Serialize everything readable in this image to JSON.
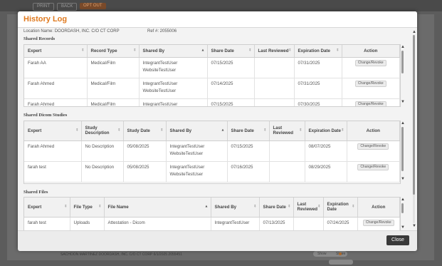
{
  "background": {
    "print_label": "PRINT",
    "back_label": "BACK",
    "opt_out_label": "OPT OUT",
    "row_text": "SACHOON MARTINEZ   DOORDASH, INC. C/O CT CORP   6/1/2025   2055451",
    "toggle_left": "Show",
    "toggle_right": "Share"
  },
  "modal": {
    "title": "History Log",
    "location_label": "Location Name: DOORDASH, INC. C/O CT CORP",
    "ref_label": "Ref #: 2055006",
    "close_label": "Close"
  },
  "shared_records": {
    "title": "Shared Records",
    "columns": [
      "Expert",
      "Record Type",
      "Shared By",
      "Share Date",
      "Last Reviewed",
      "Expiration Date",
      "Action"
    ],
    "rows": [
      {
        "expert": "Farah AA",
        "record_type": "Medical/Film",
        "shared_by_1": "IntegrantTestUser",
        "shared_by_2": "WebsiteTestUser",
        "share_date": "07/15/2025",
        "last_reviewed": "",
        "expiration_date": "07/31/2025",
        "action": "Change/Revoke"
      },
      {
        "expert": "Farah Ahmed",
        "record_type": "Medical/Film",
        "shared_by_1": "IntegrantTestUser",
        "shared_by_2": "WebsiteTestUser",
        "share_date": "07/14/2025",
        "last_reviewed": "",
        "expiration_date": "07/31/2025",
        "action": "Change/Revoke"
      },
      {
        "expert": "Farah Ahmed",
        "record_type": "Medical/Film",
        "shared_by_1": "IntegrantTestUser",
        "shared_by_2": "",
        "share_date": "07/15/2025",
        "last_reviewed": "",
        "expiration_date": "07/30/2025",
        "action": "Change/Revoke"
      }
    ]
  },
  "shared_dicom": {
    "title": "Shared Dicom Studies",
    "columns": [
      "Expert",
      "Study Description",
      "Study Date",
      "Shared By",
      "Share Date",
      "Last Reviewed",
      "Expiration Date",
      "Action"
    ],
    "rows": [
      {
        "expert": "Farah Ahmed",
        "study_description": "No Description",
        "study_date": "05/08/2025",
        "shared_by_1": "IntegrantTestUser",
        "shared_by_2": "WebsiteTestUser",
        "share_date": "07/15/2025",
        "last_reviewed": "",
        "expiration_date": "08/07/2025",
        "action": "Change/Revoke"
      },
      {
        "expert": "farah test",
        "study_description": "No Description",
        "study_date": "05/08/2025",
        "shared_by_1": "IntegrantTestUser",
        "shared_by_2": "WebsiteTestUser",
        "share_date": "07/16/2025",
        "last_reviewed": "",
        "expiration_date": "08/29/2025",
        "action": "Change/Revoke"
      }
    ]
  },
  "shared_files": {
    "title": "Shared Files",
    "columns": [
      "Expert",
      "File Type",
      "File Name",
      "Shared By",
      "Share Date",
      "Last Reviewed",
      "Expiration Date",
      "Action"
    ],
    "rows": [
      {
        "expert": "farah test",
        "file_type": "Uploads",
        "file_name": "Attestation - Dicom",
        "shared_by": "IntegrantTestUser",
        "share_date": "07/13/2025",
        "last_reviewed": "",
        "expiration_date": "07/24/2025",
        "action": "Change/Revoke"
      }
    ]
  }
}
